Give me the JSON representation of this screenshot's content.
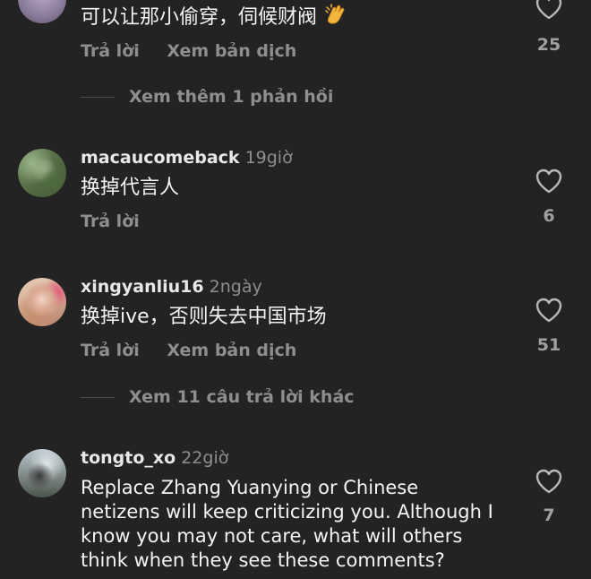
{
  "comments": [
    {
      "text": "可以让那小偷穿，伺候财阀",
      "reply_label": "Trả lời",
      "translate_label": "Xem bản dịch",
      "likes": "25",
      "more_replies": "Xem thêm 1 phản hồi"
    },
    {
      "username": "macaucomeback",
      "time": "19giờ",
      "text": "换掉代言人",
      "reply_label": "Trả lời",
      "likes": "6"
    },
    {
      "username": "xingyanliu16",
      "time": "2ngày",
      "text": "换掉ive，否则失去中国市场",
      "reply_label": "Trả lời",
      "translate_label": "Xem bản dịch",
      "likes": "51",
      "more_replies": "Xem 11 câu trả lời khác"
    },
    {
      "username": "tongto_xo",
      "time": "22giờ",
      "text_lines": [
        "Replace Zhang Yuanying or Chinese",
        "netizens will keep criticizing you. Although I",
        "know you may not care, what will others",
        "think when they see these comments?"
      ],
      "likes": "7"
    }
  ],
  "icons": {
    "heart": "heart-outline-icon",
    "emoji": "clapping-hands-emoji"
  },
  "colors": {
    "background": "#232323",
    "text": "#f4f4f4",
    "muted": "#8e8e8e"
  }
}
